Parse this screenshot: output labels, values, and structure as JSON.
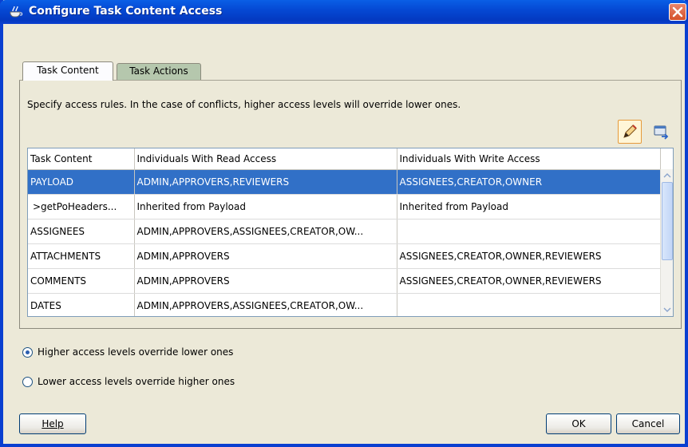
{
  "window": {
    "title": "Configure Task Content Access"
  },
  "tabs": [
    {
      "label": "Task Content",
      "active": true
    },
    {
      "label": "Task Actions",
      "active": false
    }
  ],
  "instruction": "Specify access rules. In the case of conflicts, higher access levels will override lower ones.",
  "toolbar": {
    "edit_icon": "pencil-icon",
    "other_icon": "window-arrow-icon"
  },
  "table": {
    "headers": [
      "Task Content",
      "Individuals With Read Access",
      "Individuals With Write Access"
    ],
    "rows": [
      {
        "content": "PAYLOAD",
        "read": "ADMIN,APPROVERS,REVIEWERS",
        "write": "ASSIGNEES,CREATOR,OWNER",
        "selected": true
      },
      {
        "content": ">getPoHeaders...",
        "read": "Inherited from Payload",
        "write": "Inherited from Payload"
      },
      {
        "content": "ASSIGNEES",
        "read": "ADMIN,APPROVERS,ASSIGNEES,CREATOR,OW...",
        "write": ""
      },
      {
        "content": "ATTACHMENTS",
        "read": "ADMIN,APPROVERS",
        "write": "ASSIGNEES,CREATOR,OWNER,REVIEWERS"
      },
      {
        "content": "COMMENTS",
        "read": "ADMIN,APPROVERS",
        "write": "ASSIGNEES,CREATOR,OWNER,REVIEWERS"
      },
      {
        "content": "DATES",
        "read": "ADMIN,APPROVERS,ASSIGNEES,CREATOR,OW...",
        "write": ""
      }
    ]
  },
  "options": [
    {
      "label": "Higher access levels override lower ones",
      "checked": true
    },
    {
      "label": "Lower access levels override higher ones",
      "checked": false
    }
  ],
  "buttons": {
    "help": "Help",
    "ok": "OK",
    "cancel": "Cancel"
  },
  "colors": {
    "title_bar": "#0549d4",
    "selection": "#3170c7",
    "dialog_bg": "#ece9d8"
  }
}
